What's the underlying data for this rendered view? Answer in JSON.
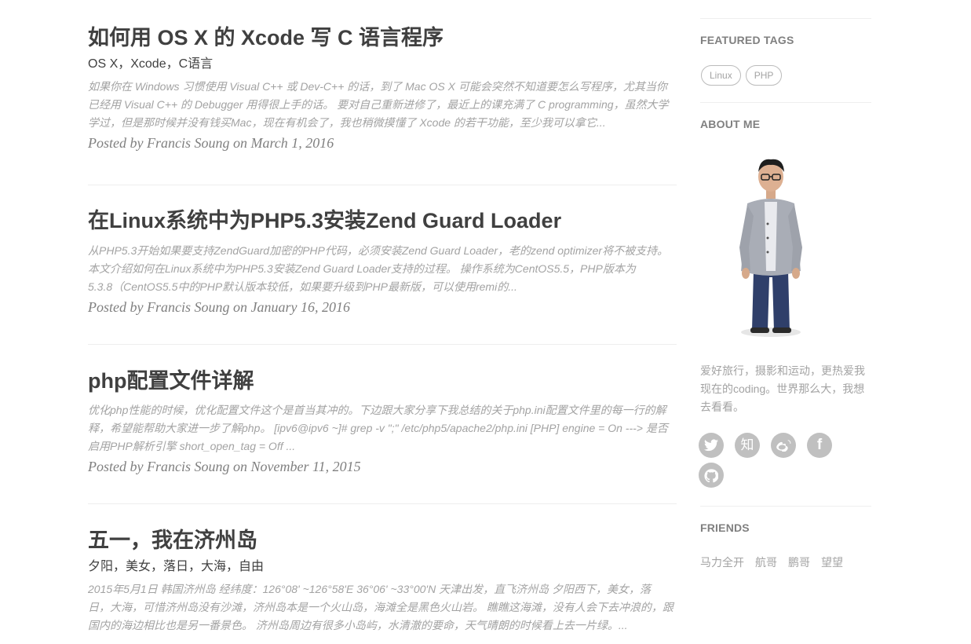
{
  "posts": [
    {
      "title": "如何用 OS X 的 Xcode 写 C 语言程序",
      "subtitle": "OS X，Xcode，C语言",
      "excerpt_lines": [
        "如果你在 Windows 习惯使用 Visual C++ 或 Dev-C++ 的话，到了 Mac OS X 可能会突然不知道要怎么写程序，尤其当你",
        "已经用 Visual C++ 的 Debugger 用得很上手的话。 要对自己重新进修了，最近上的课充满了 C programming，虽然大学",
        "学过，但是那时候并没有钱买Mac，现在有机会了，我也稍微摸懂了 Xcode 的若干功能，至少我可以拿它..."
      ],
      "meta": "Posted by Francis Soung on March 1, 2016"
    },
    {
      "title": "在Linux系统中为PHP5.3安装Zend Guard Loader",
      "subtitle": "",
      "excerpt_lines": [
        "从PHP5.3开始如果要支持ZendGuard加密的PHP代码，必须安装Zend Guard Loader，老的zend optimizer将不被支持。",
        "本文介绍如何在Linux系统中为PHP5.3安装Zend Guard Loader支持的过程。 操作系统为CentOS5.5，PHP版本为",
        "5.3.8（CentOS5.5中的PHP默认版本较低，如果要升级到PHP最新版，可以使用remi的..."
      ],
      "meta": "Posted by Francis Soung on January 16, 2016"
    },
    {
      "title": "php配置文件详解",
      "subtitle": "",
      "excerpt_lines": [
        "优化php性能的时候，优化配置文件这个是首当其冲的。下边跟大家分享下我总结的关于php.ini配置文件里的每一行的解",
        "释，希望能帮助大家进一步了解php。 [ipv6@ipv6 ~]# grep -v \";\" /etc/php5/apache2/php.ini [PHP] engine = On ---> 是否",
        "启用PHP解析引擎 short_open_tag = Off ..."
      ],
      "meta": "Posted by Francis Soung on November 11, 2015"
    },
    {
      "title": "五一，我在济州岛",
      "subtitle": "夕阳，美女，落日，大海，自由",
      "excerpt_lines": [
        "2015年5月1日 韩国济州岛 经纬度：126°08' ~126°58'E 36°06' ~33°00'N 天津出发，直飞济州岛 夕阳西下，美女，落",
        "日，大海，可惜济州岛没有沙滩，济州岛本是一个火山岛，海滩全是黑色火山岩。 瞧瞧这海滩，没有人会下去冲浪的，跟",
        "国内的海边相比也是另一番景色。 济州岛周边有很多小岛屿，水清澈的要命，天气晴朗的时候看上去一片绿。..."
      ],
      "meta": ""
    }
  ],
  "sidebar": {
    "featured_tags_title": "FEATURED TAGS",
    "tags": [
      "Linux",
      "PHP"
    ],
    "about_title": "ABOUT ME",
    "about_text": "爱好旅行，摄影和运动，更热爱我现在的coding。世界那么大，我想去看看。",
    "social": [
      {
        "icon": "twitter-icon",
        "glyph": ""
      },
      {
        "icon": "zhihu-icon",
        "glyph": "知"
      },
      {
        "icon": "weibo-icon",
        "glyph": ""
      },
      {
        "icon": "facebook-icon",
        "glyph": "f"
      },
      {
        "icon": "github-icon",
        "glyph": ""
      }
    ],
    "friends_title": "FRIENDS",
    "friends": [
      "马力全开",
      "航哥",
      "鹏哥",
      "望望"
    ]
  },
  "colors": {
    "text": "#404040",
    "muted": "#a3a3a3",
    "meta": "#808080",
    "icon_bg": "#c0c0c0",
    "divider": "#eeeeee"
  }
}
